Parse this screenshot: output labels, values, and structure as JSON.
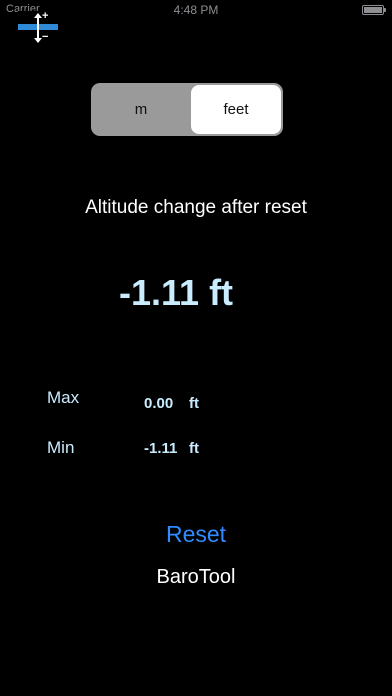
{
  "status_bar": {
    "carrier": "Carrier",
    "time": "4:48 PM",
    "battery_level": 1.0
  },
  "app_icon": {
    "icon": "barometer-altitude-icon"
  },
  "unit_toggle": {
    "options": [
      "m",
      "feet"
    ],
    "selected": "feet"
  },
  "altitude": {
    "title": "Altitude change after reset",
    "value": "-1.11 ft"
  },
  "stats": {
    "max": {
      "label": "Max",
      "value": "0.00",
      "unit": "ft"
    },
    "min": {
      "label": "Min",
      "value": "-1.11",
      "unit": "ft"
    }
  },
  "actions": {
    "reset_label": "Reset"
  },
  "footer": {
    "app_name": "BaroTool"
  },
  "colors": {
    "background": "#000000",
    "value_text": "#c9ecff",
    "accent": "#2f8bff",
    "icon_band": "#2f8bd8",
    "segment_bg": "#9a9a9a",
    "segment_selected": "#ffffff"
  }
}
